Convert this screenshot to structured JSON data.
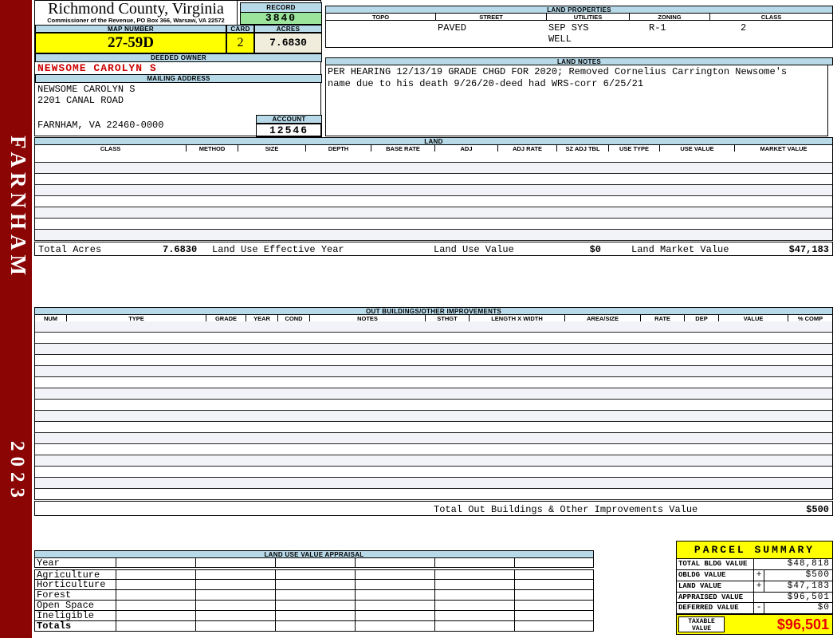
{
  "colors": {
    "sidebar_maroon": "#8b0505",
    "section_header_blue": "#b7d9e8",
    "record_green": "#9ce49c",
    "highlight_yellow": "#ffff00",
    "acres_beige": "#f0eddc",
    "owner_red": "#cc0000",
    "taxable_red": "#e60000"
  },
  "county": {
    "title": "Richmond County, Virginia",
    "subtitle": "Commissioner of the Revenue, PO Box 366, Warsaw, VA 22572"
  },
  "sidebar": {
    "district": "FARNHAM",
    "year": "2023"
  },
  "record": {
    "label": "RECORD",
    "value": "3840"
  },
  "map_number": {
    "label": "MAP NUMBER",
    "value": "27-59D"
  },
  "card": {
    "label": "CARD",
    "value": "2"
  },
  "acres": {
    "label": "ACRES",
    "value": "7.6830"
  },
  "deeded_owner": {
    "label": "DEEDED OWNER",
    "value": "NEWSOME CAROLYN S"
  },
  "mailing_address": {
    "label": "MAILING ADDRESS",
    "line1": "NEWSOME CAROLYN S",
    "line2": "2201 CANAL ROAD",
    "line3": "FARNHAM, VA 22460-0000"
  },
  "account": {
    "label": "ACCOUNT",
    "value": "12546"
  },
  "land_properties": {
    "title": "LAND PROPERTIES",
    "headers": [
      "TOPO",
      "STREET",
      "UTILITIES",
      "ZONING",
      "CLASS"
    ],
    "topo": "",
    "street": "PAVED",
    "utilities_line1": "SEP SYS",
    "utilities_line2": "WELL",
    "zoning": "R-1",
    "class_value": "2"
  },
  "land_notes": {
    "title": "LAND NOTES",
    "line1": "PER HEARING 12/13/19 GRADE CHGD FOR 2020; Removed Cornelius Carrington Newsome's",
    "line2": "name due to his death 9/26/20-deed had WRS-corr 6/25/21"
  },
  "land": {
    "title": "LAND",
    "headers": [
      "CLASS",
      "METHOD",
      "SIZE",
      "DEPTH",
      "BASE RATE",
      "ADJ",
      "ADJ RATE",
      "SZ ADJ TBL",
      "USE TYPE",
      "USE VALUE",
      "MARKET VALUE"
    ],
    "empty_rows": 8,
    "total_acres_label": "Total Acres",
    "total_acres": "7.6830",
    "effective_year_label": "Land Use Effective Year",
    "use_value_label": "Land Use Value",
    "use_value": "$0",
    "market_value_label": "Land Market Value",
    "market_value": "$47,183"
  },
  "out_buildings": {
    "title": "OUT BUILDINGS/OTHER IMPROVEMENTS",
    "headers": [
      "NUM",
      "TYPE",
      "GRADE",
      "YEAR",
      "COND",
      "NOTES",
      "STHGT",
      "LENGTH X WIDTH",
      "AREA/SIZE",
      "RATE",
      "DEP",
      "VALUE",
      "% COMP"
    ],
    "empty_rows": 16,
    "total_label": "Total Out Buildings & Other Improvements Value",
    "total_value": "$500"
  },
  "land_use_appraisal": {
    "title": "LAND USE VALUE APPRAISAL",
    "row_labels": [
      "Year",
      "Agriculture",
      "Horticulture",
      "Forest",
      "Open Space",
      "Ineligible",
      "Totals"
    ],
    "data_columns": 6
  },
  "parcel_summary": {
    "title": "PARCEL SUMMARY",
    "rows": [
      {
        "label": "TOTAL BLDG VALUE",
        "op": "",
        "value": "$48,818"
      },
      {
        "label": "OBLDG VALUE",
        "op": "+",
        "value": "$500"
      },
      {
        "label": "LAND VALUE",
        "op": "+",
        "value": "$47,183"
      },
      {
        "label": "APPRAISED VALUE",
        "op": "",
        "value": "$96,501"
      },
      {
        "label": "DEFERRED VALUE",
        "op": "-",
        "value": "$0"
      }
    ],
    "taxable_label_line1": "TAXABLE",
    "taxable_label_line2": "VALUE",
    "taxable_value": "$96,501"
  }
}
